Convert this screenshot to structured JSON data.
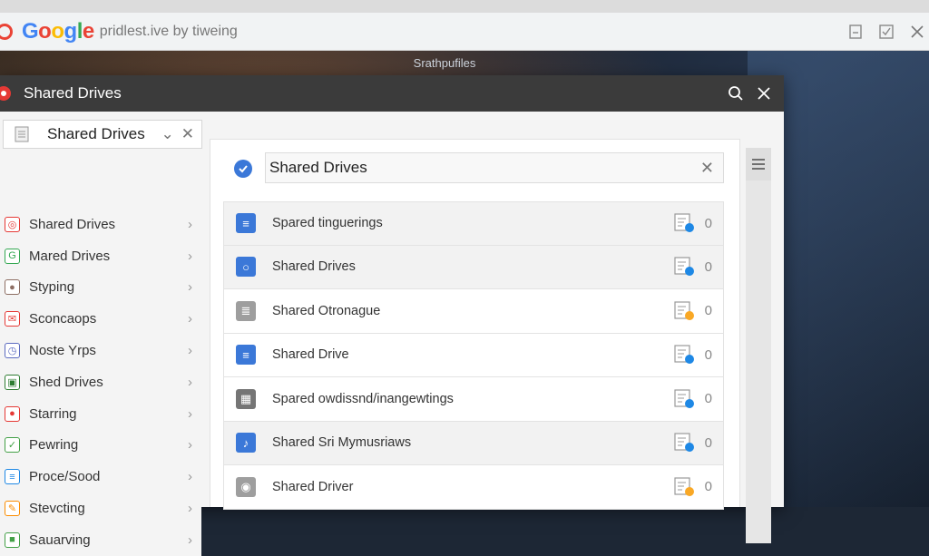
{
  "browser": {
    "logo_letters": [
      "G",
      "o",
      "o",
      "g",
      "l",
      "e"
    ],
    "address": "pridlest.ive by tiweing"
  },
  "desktop": {
    "label": "Srathpufiles"
  },
  "window": {
    "title": "Shared Drives",
    "drive_select": "Shared Drives"
  },
  "sidebar": {
    "items": [
      {
        "label": "Shared Drives",
        "icon": "instagram-icon",
        "color": "#e53935"
      },
      {
        "label": "Mared Drives",
        "icon": "g-icon",
        "color": "#34a853"
      },
      {
        "label": "Styping",
        "icon": "person-icon",
        "color": "#8d6e63"
      },
      {
        "label": "Sconcaops",
        "icon": "mail-icon",
        "color": "#e53935"
      },
      {
        "label": "Noste Yrps",
        "icon": "clock-icon",
        "color": "#5c6bc0"
      },
      {
        "label": "Shed Drives",
        "icon": "camera-icon",
        "color": "#2e7d32"
      },
      {
        "label": "Starring",
        "icon": "apple-icon",
        "color": "#e53935"
      },
      {
        "label": "Pewring",
        "icon": "check-icon",
        "color": "#43a047"
      },
      {
        "label": "Proce/Sood",
        "icon": "list-icon",
        "color": "#1e88e5"
      },
      {
        "label": "Stevcting",
        "icon": "pen-icon",
        "color": "#fb8c00"
      },
      {
        "label": "Sauarving",
        "icon": "green-icon",
        "color": "#43a047"
      }
    ]
  },
  "search": {
    "value": "Shared Drives"
  },
  "files": [
    {
      "name": "Spared tinguerings",
      "icon": "doc-icon",
      "badge": "magnify",
      "badge_color": "#1e88e5",
      "count": "0",
      "selected": true
    },
    {
      "name": "Shared Drives",
      "icon": "drive-icon",
      "badge": "info",
      "badge_color": "#1e88e5",
      "count": "0",
      "selected": true
    },
    {
      "name": "Shared Otronague",
      "icon": "cursor-doc-icon",
      "badge": "star",
      "badge_color": "#f9a825",
      "count": "0",
      "selected": false
    },
    {
      "name": "Shared Drive",
      "icon": "page-icon",
      "badge": "magnify",
      "badge_color": "#1e88e5",
      "count": "0",
      "selected": false
    },
    {
      "name": "Spared owdissnd/inangewtings",
      "icon": "calendar-icon",
      "badge": "info",
      "badge_color": "#1e88e5",
      "count": "0",
      "selected": false
    },
    {
      "name": "Shared Sri Mymusriaws",
      "icon": "music-icon",
      "badge": "g",
      "badge_color": "#1e88e5",
      "count": "0",
      "selected": true
    },
    {
      "name": "Shared Driver",
      "icon": "disk-icon",
      "badge": "star",
      "badge_color": "#f9a825",
      "count": "0",
      "selected": false
    }
  ]
}
